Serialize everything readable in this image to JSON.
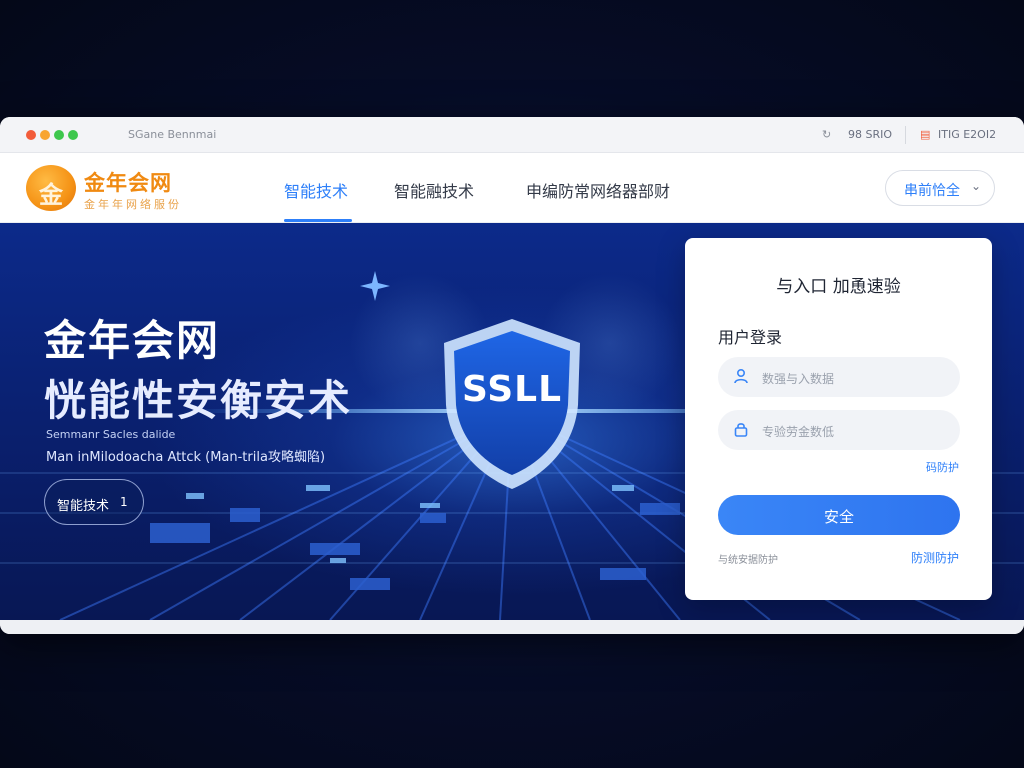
{
  "titlebar": {
    "url_text": "SGane Bennmai",
    "right_text_1": "98 SRIO",
    "right_text_2": "ITIG E2OI2",
    "dot_colors": [
      "#f25c3a",
      "#f8a531",
      "#3ec74d",
      "#3ec74d"
    ]
  },
  "header": {
    "logo_title": "金年会网",
    "logo_subtitle": "金年年网络服份",
    "logo_glyph": "金",
    "nav": [
      {
        "label": "智能技术",
        "active": true
      },
      {
        "label": "智能融技术",
        "active": false
      },
      {
        "label": "申编防常网络器部财",
        "active": false
      }
    ],
    "lang_button": "串前恰全"
  },
  "hero": {
    "title_line1": "金年会网",
    "title_line2": "恍能性安衡安术",
    "caption_line1": "Semmanr Sacles dalide",
    "caption_line2": "Man inMilodoacha Attck (Man-trila攻略蜘陷)",
    "button_label": "智能技术",
    "button_number": "1",
    "shield_text": "SSLL"
  },
  "login": {
    "title": "与入口 加恿速验",
    "subtitle": "用户登录",
    "username_placeholder": "数强与入数据",
    "password_placeholder": "专验劳金数低",
    "forgot_link": "码防护",
    "submit_label": "安全",
    "footer_left": "与统安据防护",
    "footer_right": "防测防护"
  },
  "colors": {
    "accent": "#2d7ff9",
    "brand_orange": "#f08a12",
    "hero_dark": "#081754"
  }
}
